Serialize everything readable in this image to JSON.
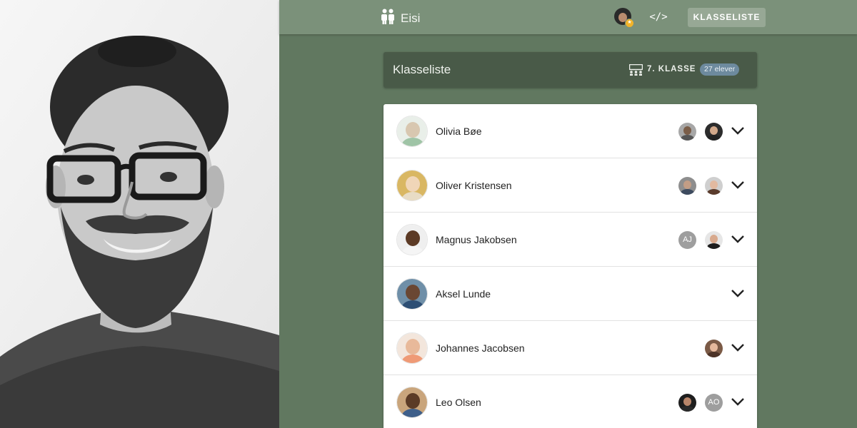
{
  "app": {
    "brand_name": "Eisi",
    "nav_button": "KLASSELISTE",
    "code_symbol": "</>"
  },
  "header": {
    "title": "Klasseliste",
    "class_label": "7. KLASSE",
    "count_badge": "27 elever"
  },
  "students": [
    {
      "name": "Olivia Bøe",
      "parents": [
        "photo",
        "photo"
      ]
    },
    {
      "name": "Oliver Kristensen",
      "parents": [
        "photo",
        "photo"
      ]
    },
    {
      "name": "Magnus Jakobsen",
      "parents": [
        "AJ",
        "photo"
      ]
    },
    {
      "name": "Aksel Lunde",
      "parents": []
    },
    {
      "name": "Johannes Jacobsen",
      "parents": [
        "photo"
      ]
    },
    {
      "name": "Leo Olsen",
      "parents": [
        "photo",
        "AO"
      ]
    }
  ],
  "colors": {
    "topbar": "#7b917a",
    "background": "#617860",
    "header_card": "#495a48",
    "badge": "#6d8a9e",
    "nav_button": "#97a895"
  },
  "icons": {
    "brand": "people-icon",
    "code": "code-icon",
    "class": "classroom-icon",
    "expand": "chevron-down-icon"
  }
}
